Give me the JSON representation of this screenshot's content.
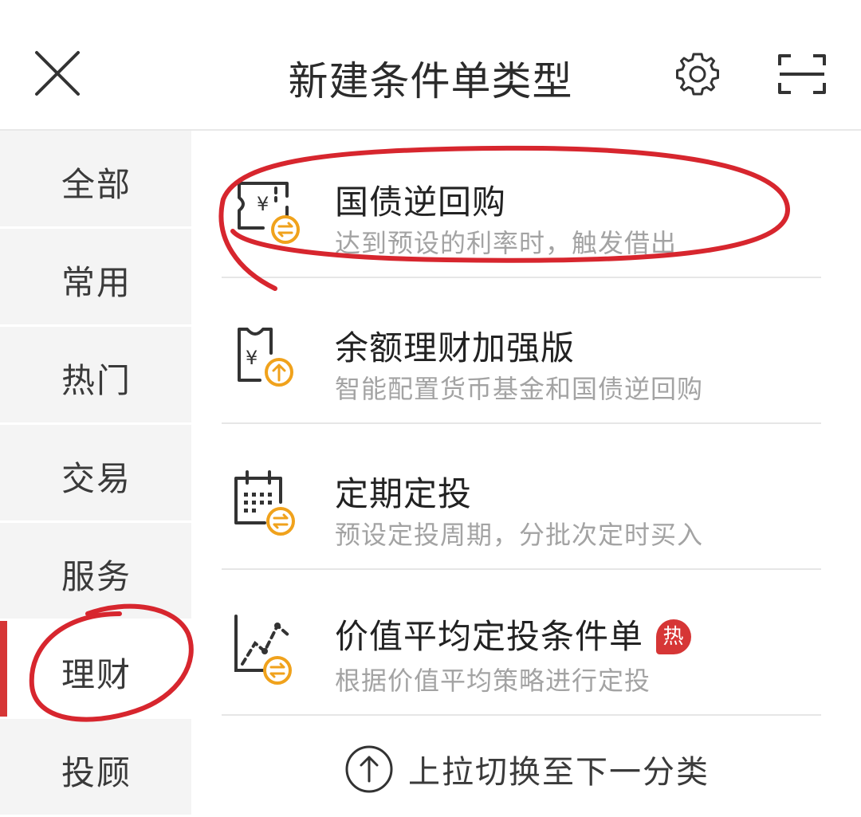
{
  "header": {
    "title": "新建条件单类型",
    "close_icon": "close-icon",
    "settings_icon": "gear-icon",
    "scan_icon": "scan-icon"
  },
  "sidebar": {
    "active": "理财",
    "items": [
      {
        "label": "全部"
      },
      {
        "label": "常用"
      },
      {
        "label": "热门"
      },
      {
        "label": "交易"
      },
      {
        "label": "服务"
      },
      {
        "label": "理财"
      },
      {
        "label": "投顾"
      }
    ]
  },
  "items": [
    {
      "title": "国债逆回购",
      "subtitle": "达到预设的利率时，触发借出",
      "icon": "repo-ticket-icon"
    },
    {
      "title": "余额理财加强版",
      "subtitle": "智能配置货币基金和国债逆回购",
      "icon": "yuan-upgrade-icon"
    },
    {
      "title": "定期定投",
      "subtitle": "预设定投周期，分批次定时买入",
      "icon": "calendar-icon"
    },
    {
      "title": "价值平均定投条件单",
      "subtitle": "根据价值平均策略进行定投",
      "icon": "chart-line-icon",
      "badge": "热"
    }
  ],
  "footer": {
    "pull_hint": "上拉切换至下一分类",
    "icon": "arrow-up-circle-icon"
  },
  "colors": {
    "accent": "#d63636",
    "badge_orange": "#f0a21c",
    "annotation_red": "#d7262e"
  }
}
